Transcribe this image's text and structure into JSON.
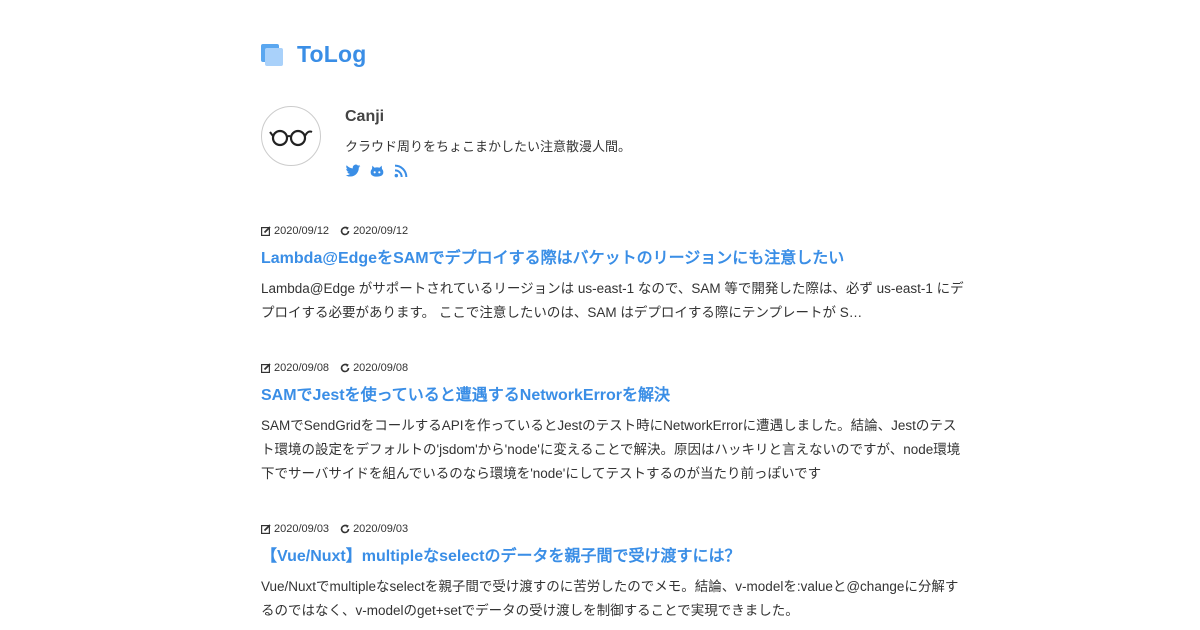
{
  "site": {
    "title": "ToLog"
  },
  "author": {
    "name": "Canji",
    "bio": "クラウド周りをちょこまかしたい注意散漫人間。"
  },
  "social": [
    {
      "icon": "twitter-icon",
      "color": "#3a8ee6"
    },
    {
      "icon": "github-icon",
      "color": "#3a8ee6"
    },
    {
      "icon": "rss-icon",
      "color": "#3a8ee6"
    }
  ],
  "posts": [
    {
      "created": "2020/09/12",
      "updated": "2020/09/12",
      "title": "Lambda@EdgeをSAMでデプロイする際はバケットのリージョンにも注意したい",
      "excerpt": "Lambda@Edge がサポートされているリージョンは us-east-1 なので、SAM 等で開発した際は、必ず us-east-1 にデプロイする必要があります。 ここで注意したいのは、SAM はデプロイする際にテンプレートが S…"
    },
    {
      "created": "2020/09/08",
      "updated": "2020/09/08",
      "title": "SAMでJestを使っていると遭遇するNetworkErrorを解決",
      "excerpt": "SAMでSendGridをコールするAPIを作っているとJestのテスト時にNetworkErrorに遭遇しました。結論、Jestのテスト環境の設定をデフォルトの'jsdom'から'node'に変えることで解決。原因はハッキリと言えないのですが、node環境下でサーバサイドを組んでいるのなら環境を'node'にしてテストするのが当たり前っぽいです"
    },
    {
      "created": "2020/09/03",
      "updated": "2020/09/03",
      "title": "【Vue/Nuxt】multipleなselectのデータを親子間で受け渡すには？",
      "excerpt": "Vue/Nuxtでmultipleなselectを親子間で受け渡すのに苦労したのでメモ。結論、v-modelを:valueと@changeに分解するのではなく、v-modelのget+setでデータの受け渡しを制御することで実現できました。"
    }
  ],
  "colors": {
    "accent": "#3a8ee6",
    "text": "#333333"
  }
}
